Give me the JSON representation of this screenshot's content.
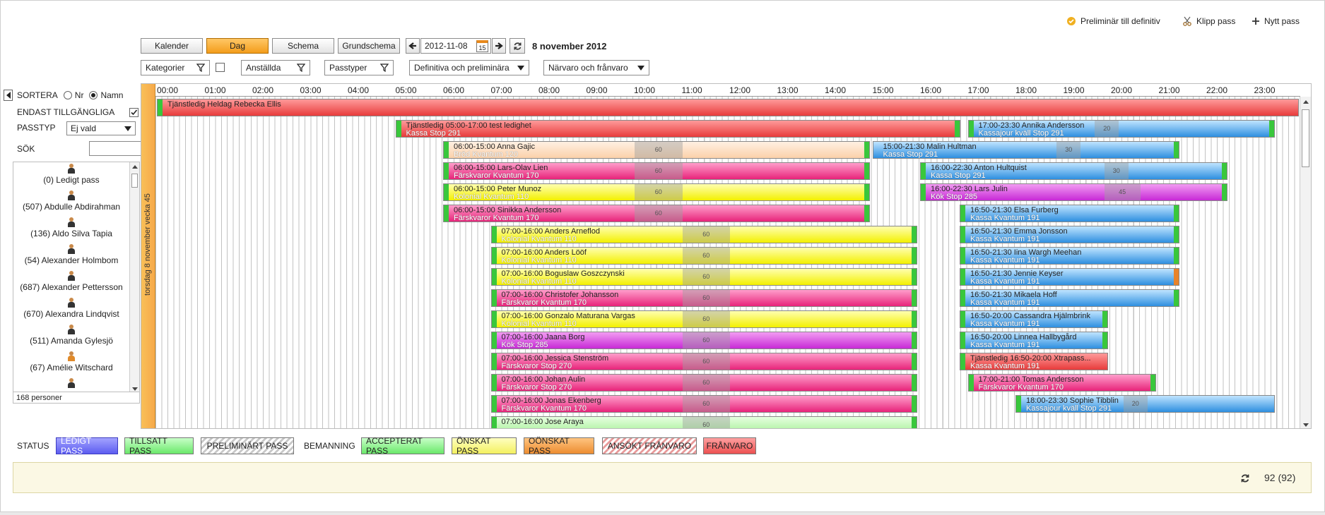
{
  "top_actions": [
    {
      "label": "Preliminär till definitiv",
      "icon": "check-circle-icon"
    },
    {
      "label": "Klipp pass",
      "icon": "scissors-icon"
    },
    {
      "label": "Nytt pass",
      "icon": "plus-icon"
    }
  ],
  "view_tabs": [
    {
      "label": "Kalender",
      "active": false
    },
    {
      "label": "Dag",
      "active": true
    },
    {
      "label": "Schema",
      "active": false
    },
    {
      "label": "Grundschema",
      "active": false
    }
  ],
  "date": {
    "value": "2012-11-08",
    "calendar_day": "15",
    "title": "8 november 2012"
  },
  "filters": [
    {
      "label": "Kategorier",
      "kind": "funnel"
    },
    {
      "label": "Anställda",
      "kind": "funnel"
    },
    {
      "label": "Passtyper",
      "kind": "funnel"
    },
    {
      "label": "Definitiva och preliminära",
      "kind": "dropdown"
    },
    {
      "label": "Närvaro och frånvaro",
      "kind": "dropdown"
    }
  ],
  "left": {
    "sort_label": "SORTERA",
    "sort_nr": "Nr",
    "sort_namn": "Namn",
    "sort_selected": "Namn",
    "only_available_label": "ENDAST TILLGÄNGLIGA",
    "passtyp_label": "PASSTYP",
    "passtyp_value": "Ej vald",
    "search_label": "SÖK",
    "search_value": "",
    "employees": [
      {
        "name": "(0) Ledigt pass",
        "gender": "m"
      },
      {
        "name": "(507) Abdulle Abdirahman",
        "gender": "m"
      },
      {
        "name": "(136) Aldo Silva Tapia",
        "gender": "m"
      },
      {
        "name": "(54) Alexander Holmbom",
        "gender": "m"
      },
      {
        "name": "(687) Alexander Pettersson",
        "gender": "m"
      },
      {
        "name": "(670) Alexandra Lindqvist",
        "gender": "m"
      },
      {
        "name": "(511) Amanda Gylesjö",
        "gender": "m"
      },
      {
        "name": "(67) Amélie  Witschard",
        "gender": "f"
      },
      {
        "name": "",
        "gender": "m"
      }
    ],
    "count": "168 personer"
  },
  "schedule": {
    "day_label": "torsdag 8 november  vecka 45",
    "hours": [
      "00:00",
      "01:00",
      "02:00",
      "03:00",
      "04:00",
      "05:00",
      "06:00",
      "07:00",
      "08:00",
      "09:00",
      "10:00",
      "11:00",
      "12:00",
      "13:00",
      "14:00",
      "15:00",
      "16:00",
      "17:00",
      "18:00",
      "19:00",
      "20:00",
      "21:00",
      "22:00",
      "23:00"
    ],
    "shifts": [
      {
        "row": 0,
        "start": 0,
        "end": 24,
        "color": "red",
        "l1": "Tjänstledig Heldag Rebecka Ellis",
        "l2": "",
        "gb": true,
        "ge": false
      },
      {
        "row": 1,
        "start": 5,
        "end": 16.9,
        "color": "red",
        "l1": "Tjänstledig 05:00-17:00 test ledighet",
        "l2": "Kassa Stop 291",
        "gb": true,
        "ge": true
      },
      {
        "row": 1,
        "start": 17,
        "end": 23.5,
        "color": "blue",
        "l1": "17:00-23:30 Annika Andersson",
        "l2": "Kassajour kväll Stop 291",
        "gb": true,
        "ge": true,
        "brk": [
          19.65,
          20.15,
          "20"
        ]
      },
      {
        "row": 2,
        "start": 6,
        "end": 15,
        "color": "peach",
        "l1": "06:00-15:00 Anna Gajic",
        "l2": "Bröd Kvantum 120",
        "gb": true,
        "ge": true,
        "brk": [
          10,
          11,
          "60"
        ]
      },
      {
        "row": 2,
        "start": 15,
        "end": 21.5,
        "color": "blue",
        "l1": "15:00-21:30 Malin Hultman",
        "l2": "Kassa Stop 291",
        "gb": false,
        "ge": true,
        "brk": [
          18.85,
          19.35,
          "30"
        ]
      },
      {
        "row": 3,
        "start": 6,
        "end": 15,
        "color": "pink",
        "l1": "06:00-15:00 Lars-Olav Lien",
        "l2": "Färskvaror Kvantum 170",
        "gb": true,
        "ge": true,
        "brk": [
          10,
          11,
          "60"
        ]
      },
      {
        "row": 3,
        "start": 16,
        "end": 22.5,
        "color": "blue",
        "l1": "16:00-22:30 Anton Hultquist",
        "l2": "Kassa Stop 291",
        "gb": true,
        "ge": true,
        "brk": [
          19.85,
          20.35,
          "30"
        ]
      },
      {
        "row": 4,
        "start": 6,
        "end": 15,
        "color": "yellow",
        "l1": "06:00-15:00 Peter Munoz",
        "l2": "Kolonial Kvantum 110",
        "gb": true,
        "ge": true,
        "brk": [
          10,
          11,
          "60"
        ]
      },
      {
        "row": 4,
        "start": 16,
        "end": 22.5,
        "color": "magenta",
        "l1": "16:00-22:30 Lars Julin",
        "l2": "Kök Stop 285",
        "gb": true,
        "ge": true,
        "brk": [
          19.85,
          20.6,
          "45"
        ]
      },
      {
        "row": 5,
        "start": 6,
        "end": 15,
        "color": "pink",
        "l1": "06:00-15:00 Sinikka Andersson",
        "l2": "Färskvaror Kvantum 170",
        "gb": true,
        "ge": true,
        "brk": [
          10,
          11,
          "60"
        ]
      },
      {
        "row": 5,
        "start": 16.83,
        "end": 21.5,
        "color": "blue",
        "l1": "16:50-21:30 Elsa Furberg",
        "l2": "Kassa Kvantum 191",
        "gb": true,
        "ge": true
      },
      {
        "row": 6,
        "start": 7,
        "end": 16,
        "color": "yellow",
        "l1": "07:00-16:00 Anders Arneflod",
        "l2": "Kolonial Kvantum 110",
        "gb": true,
        "ge": true,
        "brk": [
          11,
          12,
          "60"
        ]
      },
      {
        "row": 6,
        "start": 16.83,
        "end": 21.5,
        "color": "blue",
        "l1": "16:50-21:30 Emma Jonsson",
        "l2": "Kassa Kvantum 191",
        "gb": true,
        "ge": true
      },
      {
        "row": 7,
        "start": 7,
        "end": 16,
        "color": "yellow",
        "l1": "07:00-16:00 Anders Lööf",
        "l2": "Kolonial Kvantum 110",
        "gb": true,
        "ge": true,
        "brk": [
          11,
          12,
          "60"
        ]
      },
      {
        "row": 7,
        "start": 16.83,
        "end": 21.5,
        "color": "blue",
        "l1": "16:50-21:30 Iina Wargh Meehan",
        "l2": "Kassa Kvantum 191",
        "gb": true,
        "ge": true
      },
      {
        "row": 8,
        "start": 7,
        "end": 16,
        "color": "yellow",
        "l1": "07:00-16:00 Boguslaw Goszczynski",
        "l2": "Kolonial Kvantum 110",
        "gb": true,
        "ge": true,
        "brk": [
          11,
          12,
          "60"
        ]
      },
      {
        "row": 8,
        "start": 16.83,
        "end": 21.5,
        "color": "blue",
        "l1": "16:50-21:30 Jennie Keyser",
        "l2": "Kassa Kvantum 191",
        "gb": true,
        "ge": false,
        "geo": true
      },
      {
        "row": 9,
        "start": 7,
        "end": 16,
        "color": "pink",
        "l1": "07:00-16:00 Christofer Johansson",
        "l2": "Färskvaror Kvantum 170",
        "gb": true,
        "ge": true,
        "brk": [
          11,
          12,
          "60"
        ]
      },
      {
        "row": 9,
        "start": 16.83,
        "end": 21.5,
        "color": "blue",
        "l1": "16:50-21:30 Mikaela Hoff",
        "l2": "Kassa Kvantum 191",
        "gb": true,
        "ge": true
      },
      {
        "row": 10,
        "start": 7,
        "end": 16,
        "color": "yellow",
        "l1": "07:00-16:00 Gonzalo Maturana Vargas",
        "l2": "Kolonial Kvantum 110",
        "gb": true,
        "ge": true,
        "brk": [
          11,
          12,
          "60"
        ]
      },
      {
        "row": 10,
        "start": 16.83,
        "end": 20,
        "color": "blue",
        "l1": "16:50-20:00 Cassandra Hjälmbrink",
        "l2": "Kassa Kvantum 191",
        "gb": true,
        "ge": true
      },
      {
        "row": 11,
        "start": 7,
        "end": 16,
        "color": "magenta",
        "l1": "07:00-16:00 Jaana Borg",
        "l2": "Kök Stop 285",
        "gb": true,
        "ge": true,
        "brk": [
          11,
          12,
          "60"
        ]
      },
      {
        "row": 11,
        "start": 16.83,
        "end": 20,
        "color": "blue",
        "l1": "16:50-20:00 Linnea Hallbygård",
        "l2": "Kassa Kvantum 191",
        "gb": true,
        "ge": true
      },
      {
        "row": 12,
        "start": 7,
        "end": 16,
        "color": "pink",
        "l1": "07:00-16:00 Jessica Stenström",
        "l2": "Färskvaror Stop 270",
        "gb": true,
        "ge": true,
        "brk": [
          11,
          12,
          "60"
        ]
      },
      {
        "row": 12,
        "start": 16.83,
        "end": 20,
        "color": "red",
        "l1": "Tjänstledig 16:50-20:00 Xtrapass...",
        "l2": "Kassa Kvantum 191",
        "gb": true,
        "ge": false
      },
      {
        "row": 13,
        "start": 7,
        "end": 16,
        "color": "pink",
        "l1": "07:00-16:00 Johan Aulin",
        "l2": "Färskvaror Stop 270",
        "gb": true,
        "ge": true,
        "brk": [
          11,
          12,
          "60"
        ]
      },
      {
        "row": 13,
        "start": 17,
        "end": 21,
        "color": "pink",
        "l1": "17:00-21:00 Tomas Andersson",
        "l2": "Färskvaror Kvantum 170",
        "gb": true,
        "ge": true
      },
      {
        "row": 14,
        "start": 7,
        "end": 16,
        "color": "pink",
        "l1": "07:00-16:00 Jonas Ekenberg",
        "l2": "Färskvaror Kvantum 170",
        "gb": true,
        "ge": true,
        "brk": [
          11,
          12,
          "60"
        ]
      },
      {
        "row": 14,
        "start": 18,
        "end": 23.5,
        "color": "blue",
        "l1": "18:00-23:30 Sophie Tibblin",
        "l2": "Kassajour kväll Stop 291",
        "gb": true,
        "ge": false,
        "brk": [
          20.25,
          20.75,
          "20"
        ]
      },
      {
        "row": 15,
        "start": 7,
        "end": 16,
        "color": "lgreen",
        "l1": "07:00-16:00 Jose Araya",
        "l2": "",
        "gb": true,
        "ge": true,
        "brk": [
          11,
          12,
          "60"
        ]
      }
    ]
  },
  "status_bar": {
    "status_label": "STATUS",
    "bemanning_label": "BEMANNING",
    "status_items": [
      "LEDIGT PASS",
      "TILLSATT PASS",
      "PRELIMINÄRT PASS"
    ],
    "bemanning_items": [
      "ACCEPTERAT PASS",
      "ÖNSKAT PASS",
      "OÖNSKAT PASS",
      "ANSÖKT FRÅNVARO",
      "FRÅNVARO"
    ]
  },
  "footer": {
    "count": "92 (92)"
  },
  "colors": {
    "accent": "#f39d1b",
    "ledigt": "#6b6bef",
    "tillsatt": "#7ef07e",
    "accepterat": "#7ef07e",
    "onskat": "#f7f77a",
    "oonskat": "#f0a050",
    "franvaro": "#f07070"
  }
}
